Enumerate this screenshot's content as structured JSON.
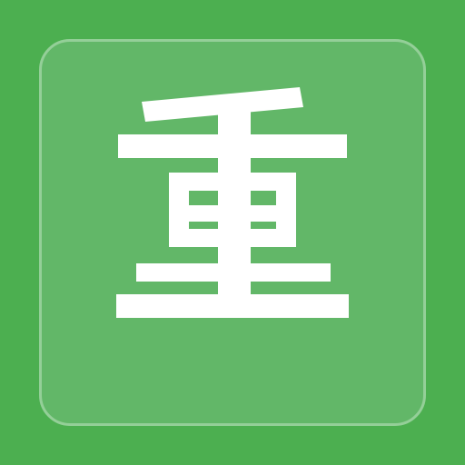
{
  "app_icon": {
    "character": "重",
    "background_color": "#4caf50",
    "tile_color": "#62b768",
    "tile_border_color": "#94cf98",
    "glyph_color": "#ffffff"
  }
}
